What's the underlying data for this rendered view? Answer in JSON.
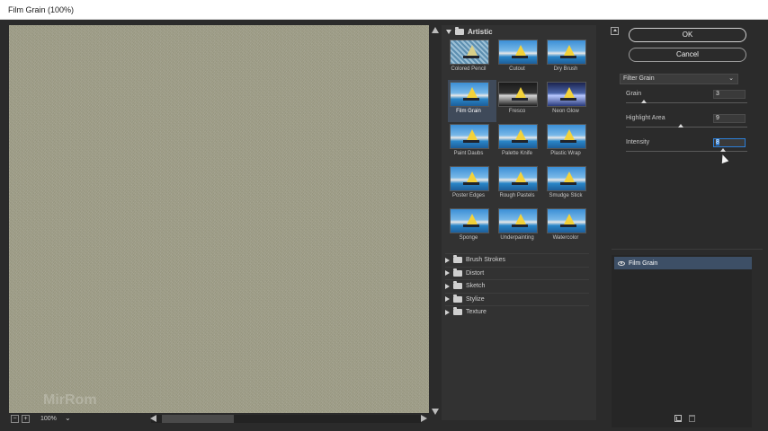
{
  "window": {
    "title": "Film Grain (100%)"
  },
  "preview": {
    "watermark": "MirRom",
    "zoom": "100%",
    "zoom_out": "−",
    "zoom_in": "+",
    "zoom_chevron": "⌄"
  },
  "gallery": {
    "category": "Artistic",
    "thumbnails": [
      {
        "label": "Colored Pencil",
        "style": "pencil"
      },
      {
        "label": "Cutout",
        "style": "normal"
      },
      {
        "label": "Dry Brush",
        "style": "normal"
      },
      {
        "label": "Film Grain",
        "style": "normal",
        "selected": true
      },
      {
        "label": "Fresco",
        "style": "dark"
      },
      {
        "label": "Neon Glow",
        "style": "neon"
      },
      {
        "label": "Paint Daubs",
        "style": "normal"
      },
      {
        "label": "Palette Knife",
        "style": "normal"
      },
      {
        "label": "Plastic Wrap",
        "style": "normal"
      },
      {
        "label": "Poster Edges",
        "style": "normal"
      },
      {
        "label": "Rough Pastels",
        "style": "normal"
      },
      {
        "label": "Smudge Stick",
        "style": "normal"
      },
      {
        "label": "Sponge",
        "style": "normal"
      },
      {
        "label": "Underpainting",
        "style": "normal"
      },
      {
        "label": "Watercolor",
        "style": "normal"
      }
    ],
    "categories": [
      "Brush Strokes",
      "Distort",
      "Sketch",
      "Stylize",
      "Texture"
    ]
  },
  "controls": {
    "ok_label": "OK",
    "cancel_label": "Cancel",
    "filter_select": "Filter Grain",
    "filter_chevron": "⌄",
    "params": [
      {
        "name": "Grain",
        "value": "3",
        "level": 0.15
      },
      {
        "name": "Highlight Area",
        "value": "9",
        "level": 0.45
      },
      {
        "name": "Intensity",
        "value": "8",
        "level": 0.8
      }
    ]
  },
  "layers": {
    "items": [
      "Film Grain"
    ]
  }
}
